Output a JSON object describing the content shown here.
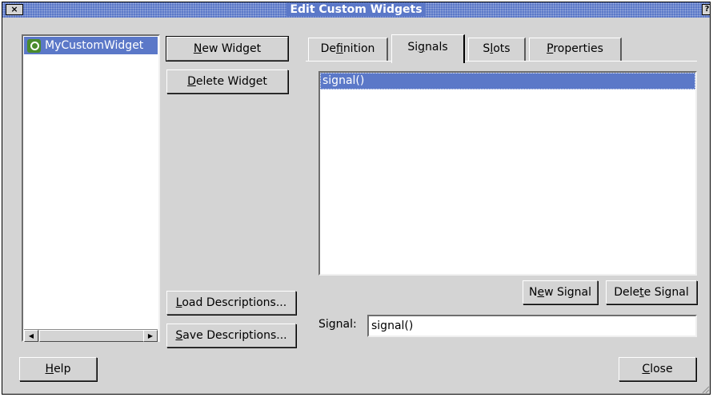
{
  "window": {
    "title": "Edit Custom Widgets",
    "close_glyph": "×",
    "help_glyph": "?"
  },
  "widget_list": {
    "items": [
      {
        "icon": "qt-logo-icon",
        "label": "MyCustomWidget"
      }
    ]
  },
  "buttons": {
    "new_widget": {
      "pre": "",
      "mnemonic": "N",
      "post": "ew Widget"
    },
    "delete_widget": {
      "pre": "",
      "mnemonic": "D",
      "post": "elete Widget"
    },
    "load_descriptions": {
      "pre": "",
      "mnemonic": "L",
      "post": "oad Descriptions..."
    },
    "save_descriptions": {
      "pre": "",
      "mnemonic": "S",
      "post": "ave Descriptions..."
    },
    "help": {
      "pre": "",
      "mnemonic": "H",
      "post": "elp"
    },
    "close": {
      "pre": "",
      "mnemonic": "C",
      "post": "lose"
    }
  },
  "tabs": [
    {
      "pre": "De",
      "mnemonic": "f",
      "post": "inition",
      "active": false
    },
    {
      "pre": "Si",
      "mnemonic": "g",
      "post": "nals",
      "active": true
    },
    {
      "pre": "S",
      "mnemonic": "l",
      "post": "ots",
      "active": false
    },
    {
      "pre": "",
      "mnemonic": "P",
      "post": "roperties",
      "active": false
    }
  ],
  "signals_tab": {
    "signal_list": [
      "signal()"
    ],
    "selected_index": 0,
    "new_signal": {
      "pre": "N",
      "mnemonic": "e",
      "post": "w Signal"
    },
    "delete_signal": {
      "pre": "Dele",
      "mnemonic": "t",
      "post": "e Signal"
    },
    "signal_label": {
      "pre": "Si",
      "mnemonic": "g",
      "post": "nal:"
    },
    "signal_value": "signal()"
  },
  "scrollbar": {
    "left_arrow": "◀",
    "right_arrow": "▶"
  },
  "colors": {
    "selection": "#5b78c8",
    "face": "#d4d4d4",
    "qt_logo": "#4a8b2c"
  }
}
